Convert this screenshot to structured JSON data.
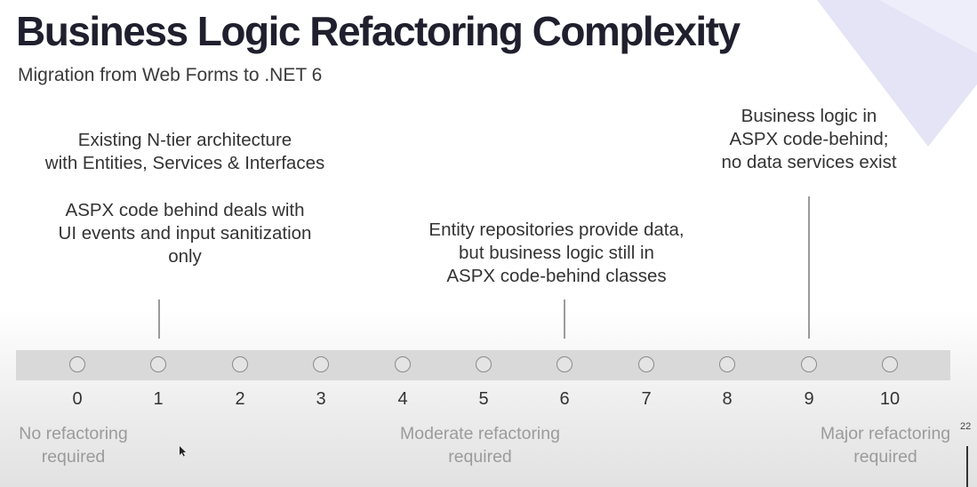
{
  "title": "Business Logic Refactoring Complexity",
  "subtitle": "Migration from Web Forms to .NET 6",
  "callouts": {
    "tier": {
      "line1": "Existing N-tier architecture",
      "line2": "with Entities, Services & Interfaces"
    },
    "aspx": {
      "line1": "ASPX code behind deals with",
      "line2": "UI events and input sanitization",
      "line3": "only"
    },
    "repos": {
      "line1": "Entity repositories provide data,",
      "line2": "but business logic still in",
      "line3": "ASPX code-behind classes"
    },
    "codebehind": {
      "line1": "Business logic in",
      "line2": "ASPX code-behind;",
      "line3": "no data services exist"
    }
  },
  "scale": {
    "values": [
      "0",
      "1",
      "2",
      "3",
      "4",
      "5",
      "6",
      "7",
      "8",
      "9",
      "10"
    ],
    "markers": [
      1,
      6,
      9
    ]
  },
  "legend": {
    "low": {
      "line1": "No refactoring",
      "line2": "required"
    },
    "mid": {
      "line1": "Moderate refactoring",
      "line2": "required"
    },
    "high": {
      "line1": "Major refactoring",
      "line2": "required"
    }
  },
  "page_number": "22",
  "colors": {
    "title": "#1f1f2e",
    "scale_bar": "#d9d9d9",
    "legend_text": "#9b9b9b",
    "accent": "#dcdcf4"
  }
}
